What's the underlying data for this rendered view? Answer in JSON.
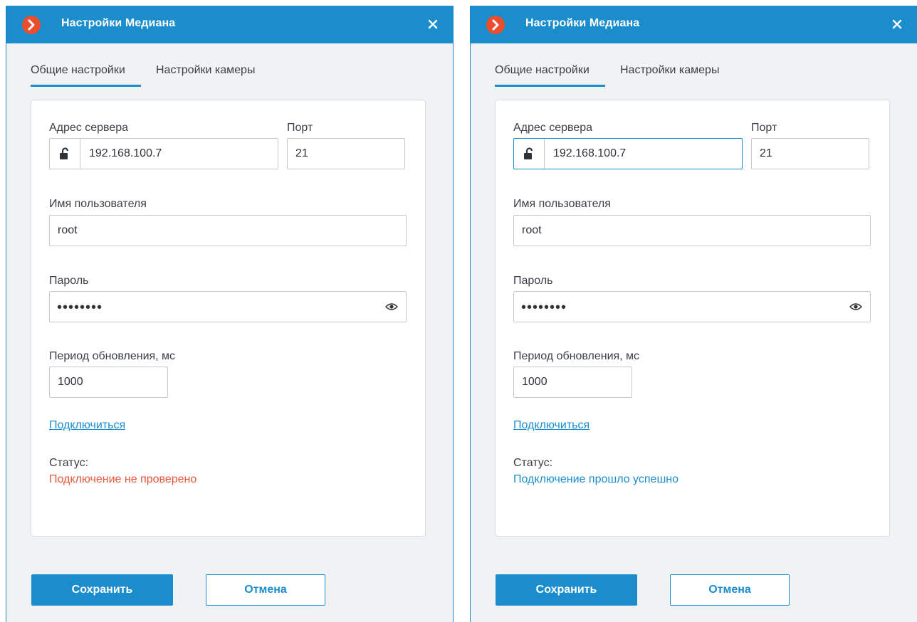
{
  "colors": {
    "accent": "#1b8dcc",
    "logo": "#e94f2e",
    "status_error": "#e8553b",
    "status_ok": "#1b8dcc",
    "background": "#f1f2f4"
  },
  "dialogs": [
    {
      "title": "Настройки Медиана",
      "tabs": [
        {
          "label": "Общие настройки",
          "active": true
        },
        {
          "label": "Настройки камеры",
          "active": false
        }
      ],
      "fields": {
        "server_address": {
          "label": "Адрес сервера",
          "value": "192.168.100.7",
          "icon": "lock-open-icon"
        },
        "port": {
          "label": "Порт",
          "value": "21"
        },
        "username": {
          "label": "Имя пользователя",
          "value": "root"
        },
        "password": {
          "label": "Пароль",
          "value": "••••••••",
          "icon": "eye-icon"
        },
        "refresh_period": {
          "label": "Период обновления, мс",
          "value": "1000"
        }
      },
      "connect_link": "Подключиться",
      "status_label": "Статус:",
      "status_text": "Подключение не проверено",
      "status_kind": "error",
      "buttons": {
        "save": "Сохранить",
        "cancel": "Отмена"
      }
    },
    {
      "title": "Настройки Медиана",
      "tabs": [
        {
          "label": "Общие настройки",
          "active": true
        },
        {
          "label": "Настройки камеры",
          "active": false
        }
      ],
      "fields": {
        "server_address": {
          "label": "Адрес сервера",
          "value": "192.168.100.7",
          "icon": "lock-open-icon",
          "focused": true
        },
        "port": {
          "label": "Порт",
          "value": "21"
        },
        "username": {
          "label": "Имя пользователя",
          "value": "root"
        },
        "password": {
          "label": "Пароль",
          "value": "••••••••",
          "icon": "eye-icon"
        },
        "refresh_period": {
          "label": "Период обновления, мс",
          "value": "1000"
        }
      },
      "connect_link": "Подключиться",
      "status_label": "Статус:",
      "status_text": "Подключение прошло успешно",
      "status_kind": "ok",
      "buttons": {
        "save": "Сохранить",
        "cancel": "Отмена"
      }
    }
  ]
}
